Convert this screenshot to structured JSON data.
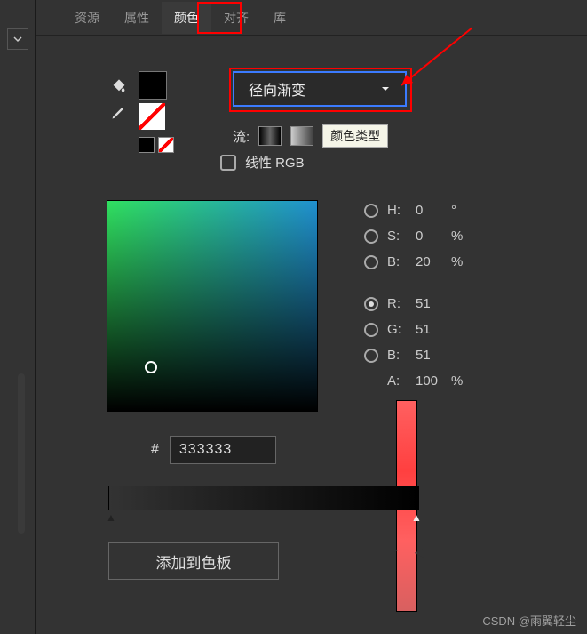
{
  "tabs": {
    "assets": "资源",
    "properties": "属性",
    "color": "颜色",
    "align": "对齐",
    "library": "库"
  },
  "gradient": {
    "type": "径向渐变",
    "tooltip": "颜色类型"
  },
  "flow_label": "流:",
  "linear_rgb": "线性 RGB",
  "hsv": {
    "h_label": "H:",
    "h_val": "0",
    "h_unit": "°",
    "s_label": "S:",
    "s_val": "0",
    "s_unit": "%",
    "b_label": "B:",
    "b_val": "20",
    "b_unit": "%"
  },
  "rgb": {
    "r_label": "R:",
    "r_val": "51",
    "g_label": "G:",
    "g_val": "51",
    "b_label": "B:",
    "b_val": "51",
    "a_label": "A:",
    "a_val": "100",
    "a_unit": "%"
  },
  "hex": {
    "prefix": "#",
    "value": "333333"
  },
  "add_swatch": "添加到色板",
  "watermark": "CSDN @雨翼轻尘"
}
